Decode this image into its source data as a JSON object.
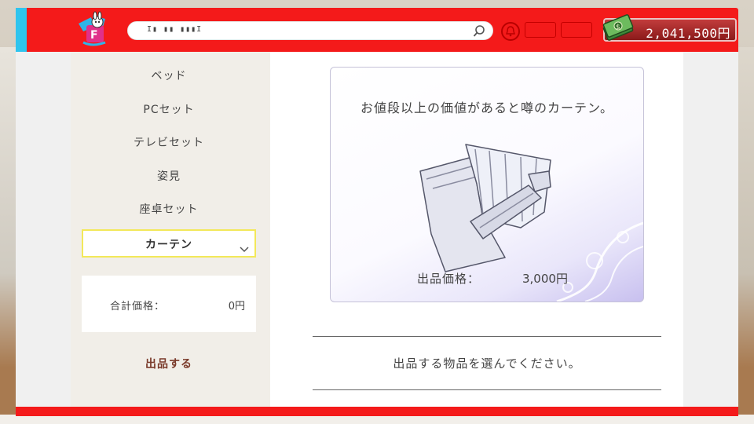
{
  "header": {
    "logo_icon": "mascot-logo-icon",
    "address_text": "I▮ ▮▮ ▮▮▮I",
    "search_icon": "search-icon",
    "notification_icon": "bell-icon",
    "balance": "2,041,500円",
    "balance_icon": "money-stack-icon"
  },
  "sidebar": {
    "categories": [
      {
        "label": "ベッド"
      },
      {
        "label": "PCセット"
      },
      {
        "label": "テレビセット"
      },
      {
        "label": "姿見"
      },
      {
        "label": "座卓セット"
      },
      {
        "label": "カーテン",
        "selected": true
      }
    ],
    "total_label": "合計価格：",
    "total_value": "0円",
    "submit_label": "出品する"
  },
  "item": {
    "description": "お値段以上の価値があると噂のカーテン。",
    "image_icon": "curtain-icon",
    "price_label": "出品価格：",
    "price_value": "3,000円"
  },
  "prompt": "出品する物品を選んでください。",
  "colors": {
    "brand_red": "#f41a1a",
    "accent_cyan": "#2fc4ee",
    "selected_border": "#f3e85a",
    "submit_text": "#7a3a2a"
  }
}
